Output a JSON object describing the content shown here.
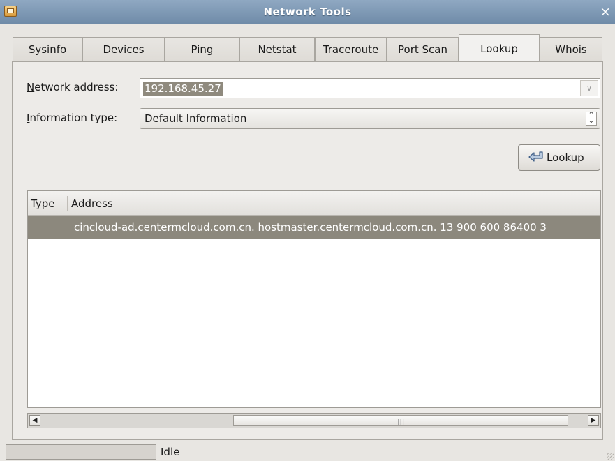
{
  "window": {
    "title": "Network Tools"
  },
  "tabs": [
    {
      "label": "Sysinfo"
    },
    {
      "label": "Devices"
    },
    {
      "label": "Ping"
    },
    {
      "label": "Netstat"
    },
    {
      "label": "Traceroute"
    },
    {
      "label": "Port Scan"
    },
    {
      "label": "Lookup",
      "active": true
    },
    {
      "label": "Whois"
    }
  ],
  "form": {
    "network_address_label_prefix": "N",
    "network_address_label_rest": "etwork address:",
    "network_address_value": "192.168.45.27",
    "info_type_label_prefix": "I",
    "info_type_label_rest": "nformation type:",
    "info_type_value": "Default Information",
    "lookup_button": "Lookup"
  },
  "results": {
    "columns": [
      "Type",
      "Address"
    ],
    "rows": [
      {
        "type": "",
        "address": "cincloud-ad.centermcloud.com.cn. hostmaster.centermcloud.com.cn. 13 900 600 86400 3"
      }
    ]
  },
  "status": {
    "text": "Idle"
  },
  "icons": {
    "app": "network-tools-icon",
    "close": "close-icon",
    "lookup": "lookup-arrow-icon"
  }
}
